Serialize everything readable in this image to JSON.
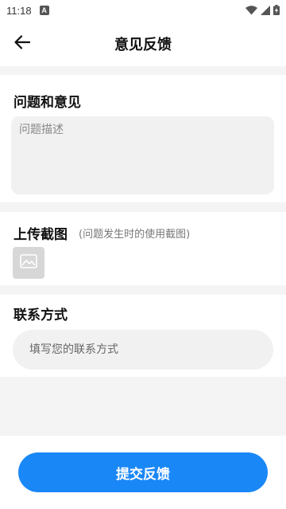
{
  "status_bar": {
    "time": "11:18",
    "notification_badge": "A",
    "icons": [
      "wifi-icon",
      "signal-icon",
      "battery-icon"
    ]
  },
  "app_bar": {
    "back_icon": "arrow-left-icon",
    "title": "意见反馈"
  },
  "feedback_section": {
    "heading": "问题和意见",
    "placeholder": "问题描述"
  },
  "upload_section": {
    "heading": "上传截图",
    "hint": "(问题发生时的使用截图)",
    "add_image_icon": "image-placeholder-icon"
  },
  "contact_section": {
    "heading": "联系方式",
    "placeholder": "填写您的联系方式"
  },
  "submit": {
    "label": "提交反馈",
    "color": "#1a87f7"
  }
}
